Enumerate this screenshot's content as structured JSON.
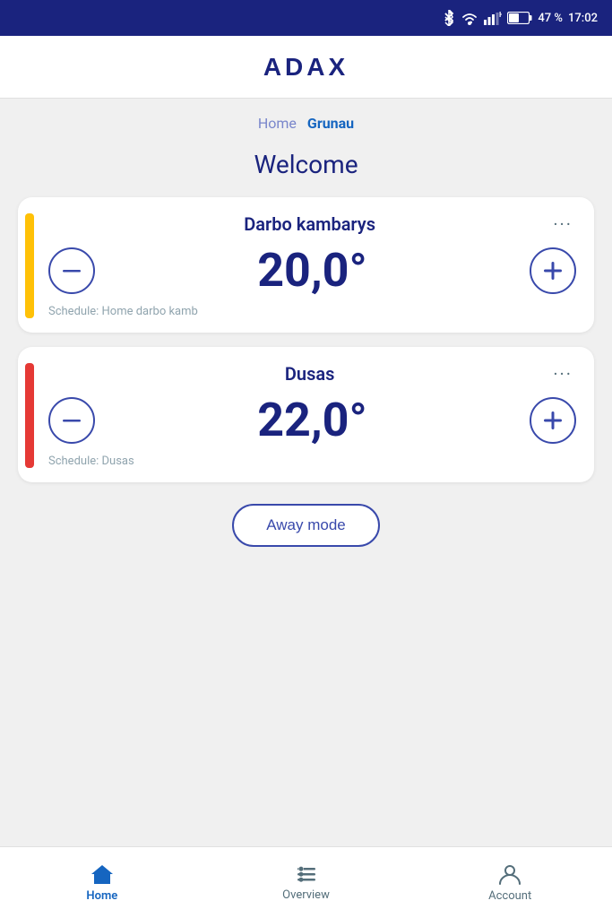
{
  "statusBar": {
    "battery": "47 %",
    "time": "17:02"
  },
  "header": {
    "logo": "ADAX"
  },
  "breadcrumb": {
    "inactive": "Home",
    "active": "Grunau"
  },
  "welcome": "Welcome",
  "rooms": [
    {
      "id": "room1",
      "name": "Darbo kambarys",
      "temperature": "20,0°",
      "schedule": "Schedule: Home darbo kamb",
      "indicatorColor": "yellow"
    },
    {
      "id": "room2",
      "name": "Dusas",
      "temperature": "22,0°",
      "schedule": "Schedule: Dusas",
      "indicatorColor": "orange"
    }
  ],
  "awayModeButton": "Away mode",
  "bottomNav": {
    "items": [
      {
        "id": "home",
        "label": "Home",
        "active": true
      },
      {
        "id": "overview",
        "label": "Overview",
        "active": false
      },
      {
        "id": "account",
        "label": "Account",
        "active": false
      }
    ]
  }
}
